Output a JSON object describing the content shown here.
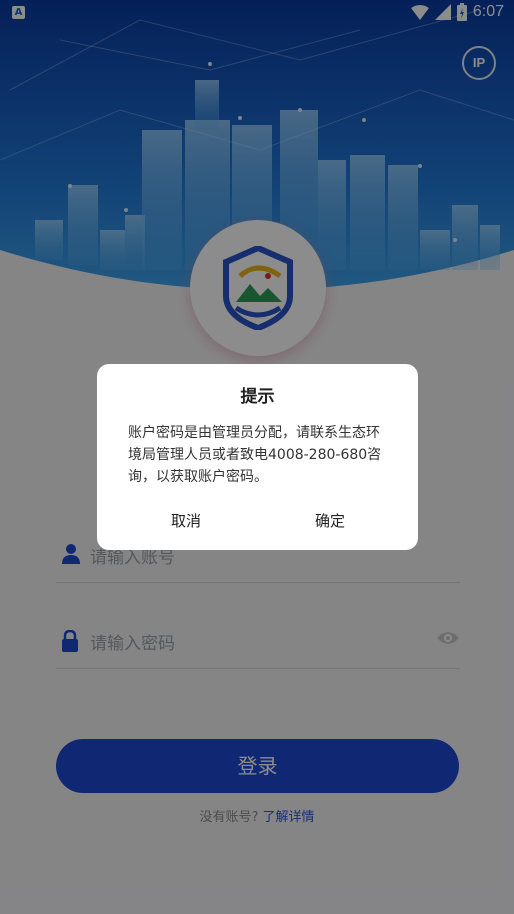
{
  "status_bar": {
    "time": "6:07",
    "notification_icon": "a-icon",
    "app_letter": "A",
    "icons": [
      "wifi-icon",
      "signal-icon",
      "battery-charging-icon"
    ]
  },
  "header": {
    "ip_label": "IP"
  },
  "form": {
    "account_placeholder": "请输入账号",
    "password_placeholder": "请输入密码",
    "login_label": "登录",
    "no_account_text": "没有账号?",
    "learn_more_link": "了解详情"
  },
  "dialog": {
    "title": "提示",
    "message": "账户密码是由管理员分配，请联系生态环境局管理人员或者致电4008-280-680咨询，以获取账户密码。",
    "cancel_label": "取消",
    "confirm_label": "确定"
  },
  "colors": {
    "primary": "#1e4ad1",
    "hero_dark": "#0d3fa8",
    "hero_light": "#2a8de0"
  }
}
